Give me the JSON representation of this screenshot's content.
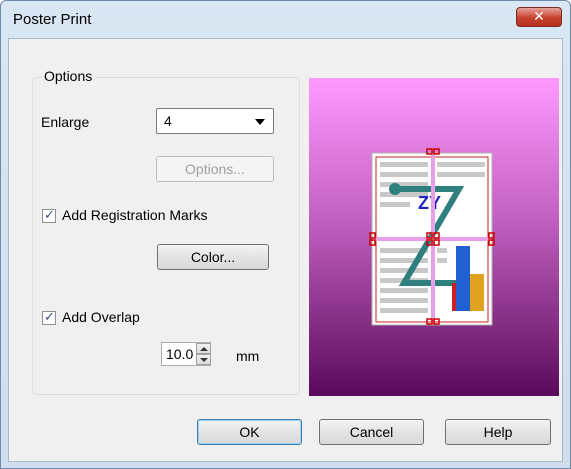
{
  "window": {
    "title": "Poster Print",
    "close_label": "✕"
  },
  "options": {
    "group_label": "Options",
    "enlarge_label": "Enlarge",
    "enlarge_value": "4",
    "options_button": "Options...",
    "registration_marks": {
      "label": "Add Registration Marks",
      "checked": true
    },
    "color_button": "Color...",
    "overlap": {
      "label": "Add Overlap",
      "checked": true,
      "value": "10.0",
      "unit": "mm"
    }
  },
  "buttons": {
    "ok": "OK",
    "cancel": "Cancel",
    "help": "Help"
  },
  "colors": {
    "preview_top": "#ff99ff",
    "preview_bottom": "#5a0a5a",
    "accent_cut_line": "#d080d0",
    "handle": "#cc0000"
  }
}
